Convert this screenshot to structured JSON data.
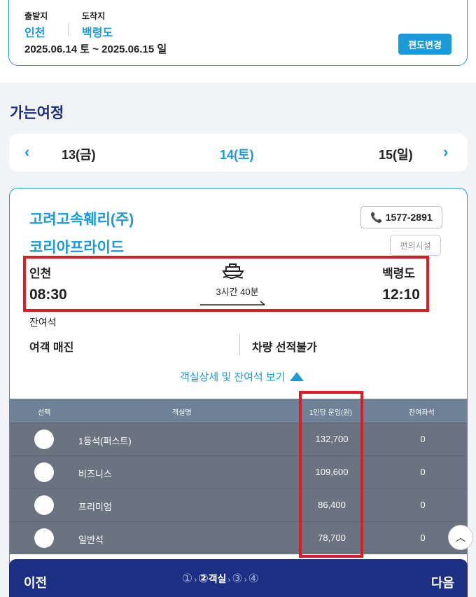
{
  "route": {
    "departure_label": "출발지",
    "arrival_label": "도착지",
    "departure_city": "인천",
    "arrival_city": "백령도",
    "date_range": "2025.06.14 토 ~ 2025.06.15 일",
    "change_button": "편도변경"
  },
  "section_title": "가는여정",
  "date_nav": {
    "prev_day": "13(금)",
    "current_day": "14(토)",
    "next_day": "15(일)"
  },
  "ship": {
    "company": "고려고속훼리(주)",
    "phone": "1577-2891",
    "name": "코리아프라이드",
    "facility_button": "편의시설",
    "departure_city": "인천",
    "arrival_city": "백령도",
    "departure_time": "08:30",
    "arrival_time": "12:10",
    "duration": "3시간 40분",
    "remaining_label": "잔여석",
    "passenger_status": "여객 매진",
    "vehicle_status": "차량 선적불가",
    "detail_toggle": "객실상세 및 잔여석 보기"
  },
  "table": {
    "headers": [
      "선택",
      "객실명",
      "1인당 운임(원)",
      "잔여좌석"
    ],
    "rows": [
      {
        "name": "1등석(퍼스트)",
        "price": "132,700",
        "seats": "0"
      },
      {
        "name": "비즈니스",
        "price": "109,600",
        "seats": "0"
      },
      {
        "name": "프리미엄",
        "price": "86,400",
        "seats": "0"
      },
      {
        "name": "일반석",
        "price": "78,700",
        "seats": "0"
      }
    ]
  },
  "bottom_bar": {
    "prev": "이전",
    "next": "다음",
    "step1": "①",
    "step2": "②",
    "step2_label": "객실",
    "step3": "③",
    "step4": "④"
  },
  "colors": {
    "accent": "#1a9bd7",
    "navy": "#1c2f82",
    "highlight": "#e11b22"
  }
}
